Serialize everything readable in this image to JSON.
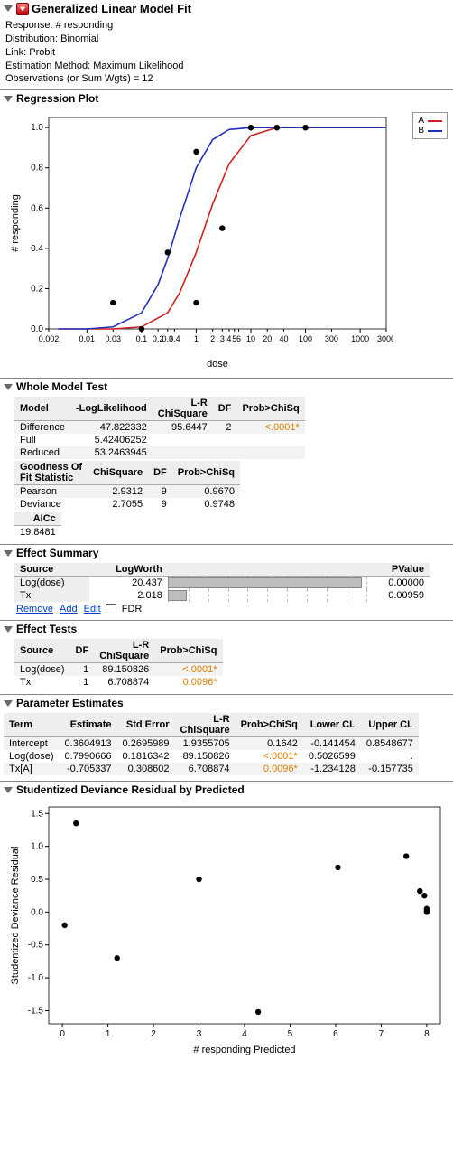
{
  "header": {
    "title": "Generalized Linear Model Fit",
    "meta": [
      "Response: # responding",
      "Distribution: Binomial",
      "Link: Probit",
      "Estimation Method: Maximum Likelihood",
      "Observations (or Sum Wgts) = 12"
    ]
  },
  "regression_plot": {
    "title": "Regression Plot",
    "xlabel": "dose",
    "ylabel": "# responding",
    "legend": [
      {
        "name": "A",
        "color": "#d02020"
      },
      {
        "name": "B",
        "color": "#2030c0"
      }
    ]
  },
  "chart_data": [
    {
      "type": "line",
      "title": "Regression Plot",
      "xlabel": "dose",
      "ylabel": "# responding",
      "x_scale": "log",
      "xlim": [
        0.002,
        3000
      ],
      "ylim": [
        0.0,
        1.05
      ],
      "xticks": [
        0.002,
        0.01,
        0.03,
        0.1,
        0.2,
        0.3,
        0.4,
        1,
        2,
        3,
        4,
        5,
        6,
        10,
        20,
        40,
        100,
        300,
        1000,
        3000
      ],
      "yticks": [
        0.0,
        0.2,
        0.4,
        0.6,
        0.8,
        1.0
      ],
      "series": [
        {
          "name": "A",
          "color": "#d02020",
          "x": [
            0.003,
            0.01,
            0.03,
            0.1,
            0.3,
            0.5,
            1,
            2,
            4,
            10,
            30,
            100,
            1000,
            3000
          ],
          "y": [
            0.0,
            0.0,
            0.0,
            0.01,
            0.08,
            0.18,
            0.38,
            0.62,
            0.82,
            0.96,
            1.0,
            1.0,
            1.0,
            1.0
          ]
        },
        {
          "name": "B",
          "color": "#2030c0",
          "x": [
            0.003,
            0.01,
            0.03,
            0.1,
            0.2,
            0.3,
            0.5,
            1,
            2,
            4,
            10,
            30,
            100,
            1000,
            3000
          ],
          "y": [
            0.0,
            0.0,
            0.01,
            0.08,
            0.22,
            0.35,
            0.55,
            0.8,
            0.94,
            0.99,
            1.0,
            1.0,
            1.0,
            1.0,
            1.0
          ]
        }
      ],
      "scatter": [
        {
          "x": 0.03,
          "y": 0.13
        },
        {
          "x": 0.1,
          "y": 0.0
        },
        {
          "x": 0.3,
          "y": 0.38
        },
        {
          "x": 1,
          "y": 0.13
        },
        {
          "x": 1,
          "y": 0.88
        },
        {
          "x": 3,
          "y": 0.5
        },
        {
          "x": 10,
          "y": 1.0
        },
        {
          "x": 10,
          "y": 1.0
        },
        {
          "x": 30,
          "y": 1.0
        },
        {
          "x": 30,
          "y": 1.0
        },
        {
          "x": 100,
          "y": 1.0
        },
        {
          "x": 100,
          "y": 1.0
        }
      ]
    },
    {
      "type": "scatter",
      "title": "Studentized Deviance Residual by Predicted",
      "xlabel": "# responding Predicted",
      "ylabel": "Studentized Deviance Residual",
      "xlim": [
        -0.3,
        8.3
      ],
      "ylim": [
        -1.7,
        1.6
      ],
      "xticks": [
        0,
        1,
        2,
        3,
        4,
        5,
        6,
        7,
        8
      ],
      "yticks": [
        -1.5,
        -1.0,
        -0.5,
        0.0,
        0.5,
        1.0,
        1.5
      ],
      "points": [
        {
          "x": 0.05,
          "y": -0.2
        },
        {
          "x": 0.3,
          "y": 1.35
        },
        {
          "x": 1.2,
          "y": -0.7
        },
        {
          "x": 3.0,
          "y": 0.5
        },
        {
          "x": 4.3,
          "y": -1.52
        },
        {
          "x": 6.05,
          "y": 0.68
        },
        {
          "x": 7.55,
          "y": 0.85
        },
        {
          "x": 7.85,
          "y": 0.32
        },
        {
          "x": 7.95,
          "y": 0.25
        },
        {
          "x": 8.0,
          "y": 0.05
        },
        {
          "x": 8.0,
          "y": 0.02
        },
        {
          "x": 8.0,
          "y": 0.0
        }
      ]
    }
  ],
  "whole_model": {
    "title": "Whole Model Test",
    "cols": [
      "Model",
      "-LogLikelihood",
      "L-R\nChiSquare",
      "DF",
      "Prob>ChiSq"
    ],
    "rows": [
      {
        "model": "Difference",
        "nll": "47.822332",
        "lr": "95.6447",
        "df": "2",
        "p": "<.0001*",
        "sig": true
      },
      {
        "model": "Full",
        "nll": "5.42406252",
        "lr": "",
        "df": "",
        "p": ""
      },
      {
        "model": "Reduced",
        "nll": "53.2463945",
        "lr": "",
        "df": "",
        "p": ""
      }
    ],
    "gof_cols": [
      "Goodness Of\nFit Statistic",
      "ChiSquare",
      "DF",
      "Prob>ChiSq"
    ],
    "gof_rows": [
      {
        "s": "Pearson",
        "chi": "2.9312",
        "df": "9",
        "p": "0.9670"
      },
      {
        "s": "Deviance",
        "chi": "2.7055",
        "df": "9",
        "p": "0.9748"
      }
    ],
    "aicc_label": "AICc",
    "aicc": "19.8481"
  },
  "effect_summary": {
    "title": "Effect Summary",
    "cols": [
      "Source",
      "LogWorth",
      "",
      "PValue"
    ],
    "rows": [
      {
        "source": "Log(dose)",
        "lw": "20.437",
        "bar": 0.98,
        "p": "0.00000"
      },
      {
        "source": "Tx",
        "lw": "2.018",
        "bar": 0.097,
        "p": "0.00959"
      }
    ],
    "links": [
      "Remove",
      "Add",
      "Edit"
    ],
    "fdr": "FDR"
  },
  "effect_tests": {
    "title": "Effect Tests",
    "cols": [
      "Source",
      "DF",
      "L-R\nChiSquare",
      "Prob>ChiSq"
    ],
    "rows": [
      {
        "s": "Log(dose)",
        "df": "1",
        "chi": "89.150826",
        "p": "<.0001*",
        "sig": true
      },
      {
        "s": "Tx",
        "df": "1",
        "chi": "6.708874",
        "p": "0.0096*",
        "sig": true
      }
    ]
  },
  "param_est": {
    "title": "Parameter Estimates",
    "cols": [
      "Term",
      "Estimate",
      "Std Error",
      "L-R\nChiSquare",
      "Prob>ChiSq",
      "Lower CL",
      "Upper CL"
    ],
    "rows": [
      {
        "t": "Intercept",
        "e": "0.3604913",
        "se": "0.2695989",
        "chi": "1.9355705",
        "p": "0.1642",
        "lo": "-0.141454",
        "hi": "0.8548677"
      },
      {
        "t": "Log(dose)",
        "e": "0.7990666",
        "se": "0.1816342",
        "chi": "89.150826",
        "p": "<.0001*",
        "sig": true,
        "lo": "0.5026599",
        "hi": "."
      },
      {
        "t": "Tx[A]",
        "e": "-0.705337",
        "se": "0.308602",
        "chi": "6.708874",
        "p": "0.0096*",
        "sig": true,
        "lo": "-1.234128",
        "hi": "-0.157735"
      }
    ]
  },
  "resid_plot": {
    "title": "Studentized Deviance Residual by Predicted"
  }
}
